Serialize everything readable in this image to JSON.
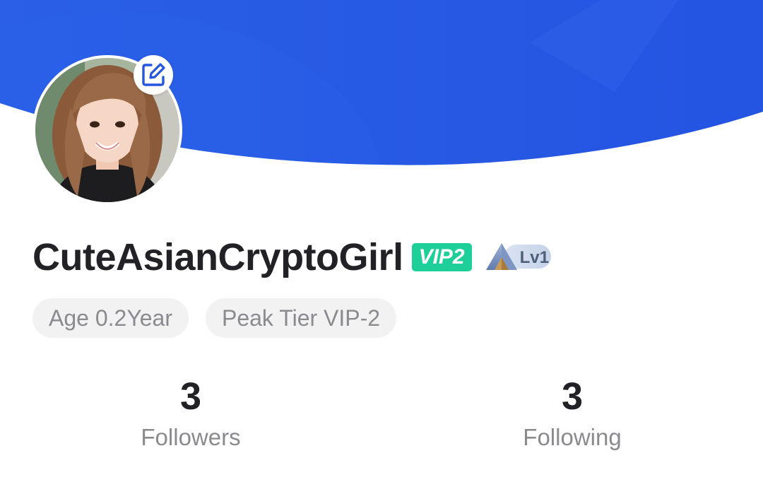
{
  "header": {
    "background_color": "#2656e0",
    "accent_color": "#2e63ea"
  },
  "profile": {
    "avatar_icon": "avatar-photo",
    "edit_icon": "edit-icon",
    "username": "CuteAsianCryptoGirl",
    "vip_badge": "VIP2",
    "level_badge": "Lv1",
    "tags": [
      "Age 0.2Year",
      "Peak Tier VIP-2"
    ]
  },
  "stats": {
    "followers": {
      "count": "3",
      "label": "Followers"
    },
    "following": {
      "count": "3",
      "label": "Following"
    }
  },
  "colors": {
    "vip_green": "#1fcf9a",
    "text_primary": "#222226",
    "text_secondary": "#8a8a8f",
    "tag_bg": "#f2f2f3"
  }
}
